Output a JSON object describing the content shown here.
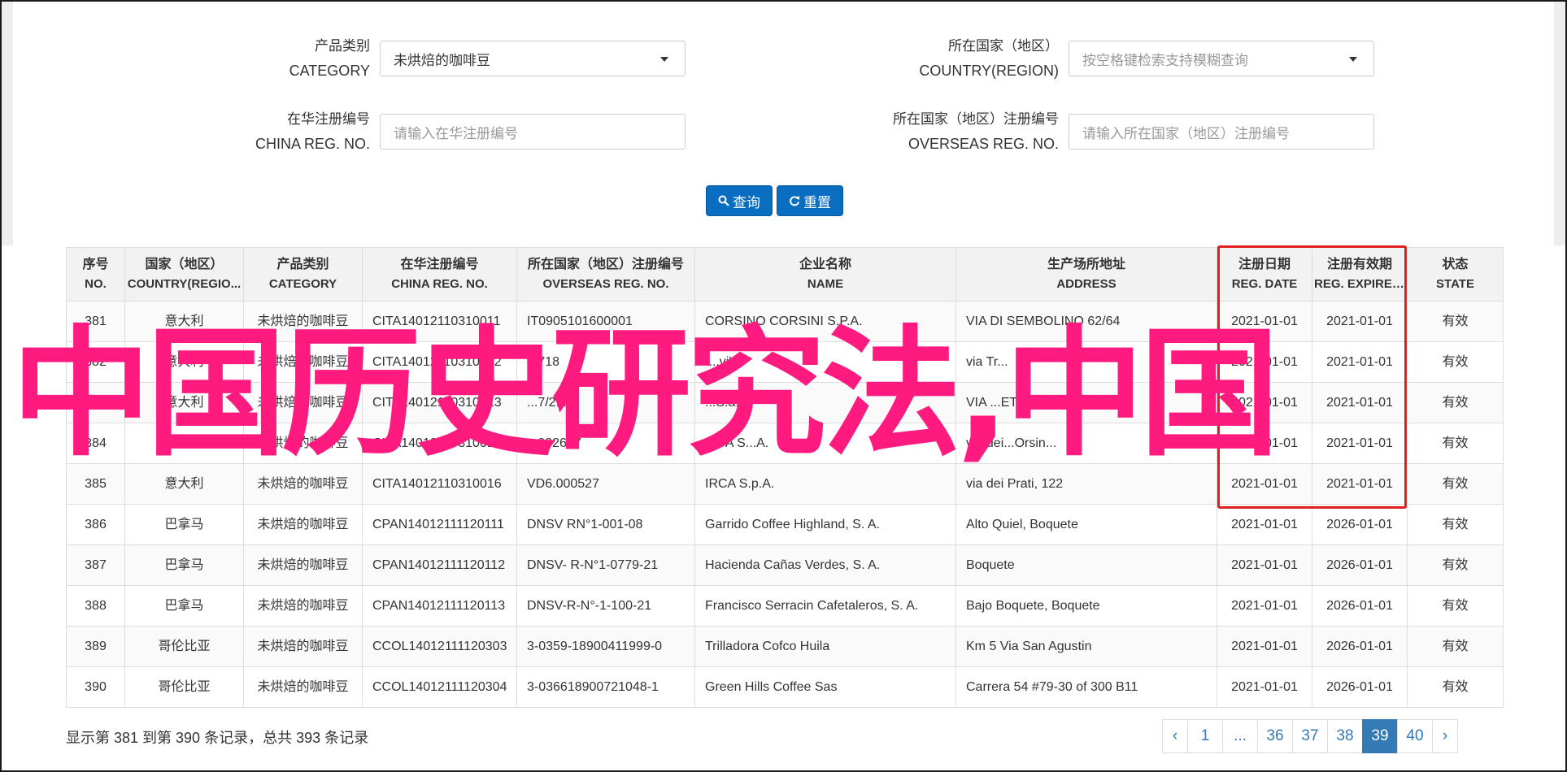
{
  "form": {
    "category": {
      "label_zh": "产品类别",
      "label_en": "CATEGORY",
      "value": "未烘焙的咖啡豆"
    },
    "country": {
      "label_zh": "所在国家（地区）",
      "label_en": "COUNTRY(REGION)",
      "placeholder": "按空格键检索支持模糊查询"
    },
    "china_reg": {
      "label_zh": "在华注册编号",
      "label_en": "CHINA REG. NO.",
      "placeholder": "请输入在华注册编号"
    },
    "overseas_reg": {
      "label_zh": "所在国家（地区）注册编号",
      "label_en": "OVERSEAS REG. NO.",
      "placeholder": "请输入所在国家（地区）注册编号"
    },
    "search_label": "查询",
    "reset_label": "重置",
    "accent_color": "#0a6ec0"
  },
  "table": {
    "headers": [
      {
        "zh": "序号",
        "en": "NO."
      },
      {
        "zh": "国家（地区）",
        "en": "COUNTRY(REGIO..."
      },
      {
        "zh": "产品类别",
        "en": "CATEGORY"
      },
      {
        "zh": "在华注册编号",
        "en": "CHINA REG. NO."
      },
      {
        "zh": "所在国家（地区）注册编号",
        "en": "OVERSEAS REG. NO."
      },
      {
        "zh": "企业名称",
        "en": "NAME"
      },
      {
        "zh": "生产场所地址",
        "en": "ADDRESS"
      },
      {
        "zh": "注册日期",
        "en": "REG. DATE"
      },
      {
        "zh": "注册有效期",
        "en": "REG. EXPIRE ..."
      },
      {
        "zh": "状态",
        "en": "STATE"
      }
    ],
    "rows": [
      [
        "381",
        "意大利",
        "未烘焙的咖啡豆",
        "CITA14012110310011",
        "IT0905101600001",
        "CORSINO CORSINI S.P.A.",
        "VIA DI SEMBOLINO 62/64",
        "2021-01-01",
        "2021-01-01",
        "有效"
      ],
      [
        "382",
        "意大利",
        "未烘焙的咖啡豆",
        "CITA14012110310012",
        "...718",
        "I...vi'",
        "via Tr...",
        "2021-01-01",
        "2021-01-01",
        "有效"
      ],
      [
        "383",
        "意大利",
        "未烘焙的咖啡豆",
        "CITA14012110310013",
        "...7/2...",
        "...S.a.a",
        "VIA ...ETTI 11",
        "2021-01-01",
        "2021-01-01",
        "有效"
      ],
      [
        "384",
        "意大利",
        "未烘焙的咖啡豆",
        "CITA14012110310014",
        "...002697",
        "...CA S...A.",
        "via dei...Orsin...",
        "2021-01-01",
        "2021-01-01",
        "有效"
      ],
      [
        "385",
        "意大利",
        "未烘焙的咖啡豆",
        "CITA14012110310016",
        "VD6.000527",
        "IRCA S.p.A.",
        "via dei Prati, 122",
        "2021-01-01",
        "2021-01-01",
        "有效"
      ],
      [
        "386",
        "巴拿马",
        "未烘焙的咖啡豆",
        "CPAN14012111120111",
        "DNSV RN°1-001-08",
        "Garrido Coffee Highland, S. A.",
        "Alto Quiel, Boquete",
        "2021-01-01",
        "2026-01-01",
        "有效"
      ],
      [
        "387",
        "巴拿马",
        "未烘焙的咖啡豆",
        "CPAN14012111120112",
        "DNSV- R-N°1-0779-21",
        "Hacienda Cañas Verdes, S. A.",
        "Boquete",
        "2021-01-01",
        "2026-01-01",
        "有效"
      ],
      [
        "388",
        "巴拿马",
        "未烘焙的咖啡豆",
        "CPAN14012111120113",
        "DNSV-R-N°-1-100-21",
        "Francisco Serracin Cafetaleros, S. A.",
        "Bajo Boquete, Boquete",
        "2021-01-01",
        "2026-01-01",
        "有效"
      ],
      [
        "389",
        "哥伦比亚",
        "未烘焙的咖啡豆",
        "CCOL14012111120303",
        "3-0359-18900411999-0",
        "Trilladora Cofco Huila",
        "Km 5 Via San Agustin",
        "2021-01-01",
        "2026-01-01",
        "有效"
      ],
      [
        "390",
        "哥伦比亚",
        "未烘焙的咖啡豆",
        "CCOL14012111120304",
        "3-036618900721048-1",
        "Green Hills Coffee Sas",
        "Carrera 54 #79-30 of 300 B11",
        "2021-01-01",
        "2026-01-01",
        "有效"
      ]
    ]
  },
  "overlay": {
    "text": "中国历史研究法,中国",
    "color": "#ff1a80"
  },
  "highlight_color": "#e02020",
  "footer": {
    "summary": "显示第 381 到第 390 条记录，总共 393 条记录"
  },
  "pager": {
    "items": [
      "‹",
      "1",
      "...",
      "36",
      "37",
      "38",
      "39",
      "40",
      "›"
    ],
    "active": "39"
  }
}
